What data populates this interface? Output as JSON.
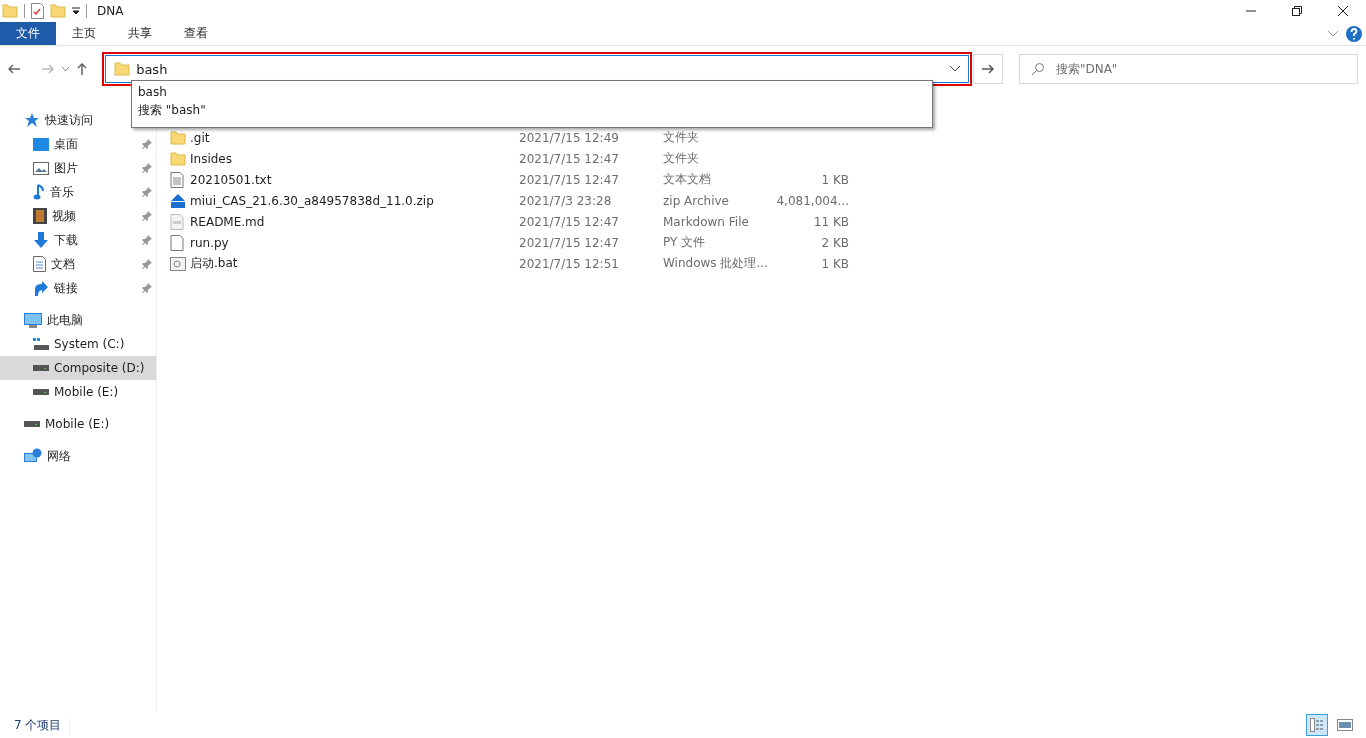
{
  "window": {
    "title": "DNA"
  },
  "ribbon_tabs": [
    {
      "label": "文件",
      "kind": "file_menu"
    },
    {
      "label": "主页",
      "kind": "tab"
    },
    {
      "label": "共享",
      "kind": "tab"
    },
    {
      "label": "查看",
      "kind": "tab"
    }
  ],
  "address_bar": {
    "value": "bash",
    "highlighted": true
  },
  "suggestions": [
    "bash",
    "搜索 \"bash\""
  ],
  "search": {
    "placeholder": "搜索\"DNA\""
  },
  "sidebar": [
    {
      "label": "快速访问",
      "kind": "star",
      "selected": false,
      "children": [
        {
          "label": "桌面",
          "kind": "desktop",
          "pinned": true,
          "selected": false
        },
        {
          "label": "图片",
          "kind": "pictures",
          "pinned": true,
          "selected": false
        },
        {
          "label": "音乐",
          "kind": "music",
          "pinned": true,
          "selected": false
        },
        {
          "label": "视频",
          "kind": "video",
          "pinned": true,
          "selected": false
        },
        {
          "label": "下载",
          "kind": "download",
          "pinned": true,
          "selected": false
        },
        {
          "label": "文档",
          "kind": "documents",
          "pinned": true,
          "selected": false
        },
        {
          "label": "链接",
          "kind": "links",
          "pinned": true,
          "selected": false
        }
      ]
    },
    {
      "label": "此电脑",
      "kind": "computer",
      "selected": false,
      "children": [
        {
          "label": "System (C:)",
          "kind": "system_drive",
          "pinned": false,
          "selected": false
        },
        {
          "label": "Composite (D:)",
          "kind": "drive",
          "pinned": false,
          "selected": true
        },
        {
          "label": "Mobile (E:)",
          "kind": "drive",
          "pinned": false,
          "selected": false
        }
      ]
    },
    {
      "label": "Mobile (E:)",
      "kind": "drive",
      "selected": false
    },
    {
      "label": "网络",
      "kind": "network",
      "selected": false
    }
  ],
  "files": [
    {
      "name": ".git",
      "modified": "2021/7/15 12:49",
      "type": "文件夹",
      "kind": "folder"
    },
    {
      "name": "Insides",
      "modified": "2021/7/15 12:47",
      "type": "文件夹",
      "kind": "folder"
    },
    {
      "name": "20210501.txt",
      "modified": "2021/7/15 12:47",
      "type": "文本文档",
      "size": "1 KB",
      "kind": "text"
    },
    {
      "name": "miui_CAS_21.6.30_a84957838d_11.0.zip",
      "modified": "2021/7/3 23:28",
      "type": "zip Archive",
      "size": "4,081,004...",
      "kind": "zip"
    },
    {
      "name": "README.md",
      "modified": "2021/7/15 12:47",
      "type": "Markdown File",
      "size": "11 KB",
      "kind": "markdown"
    },
    {
      "name": "run.py",
      "modified": "2021/7/15 12:47",
      "type": "PY 文件",
      "size": "2 KB",
      "kind": "blank"
    },
    {
      "name": "启动.bat",
      "modified": "2021/7/15 12:51",
      "type": "Windows 批处理...",
      "size": "1 KB",
      "kind": "batch"
    }
  ],
  "status_bar": {
    "count": "7 个项目"
  },
  "view_buttons": [
    {
      "kind": "details",
      "selected": true
    },
    {
      "kind": "thumbnails",
      "selected": false
    }
  ]
}
